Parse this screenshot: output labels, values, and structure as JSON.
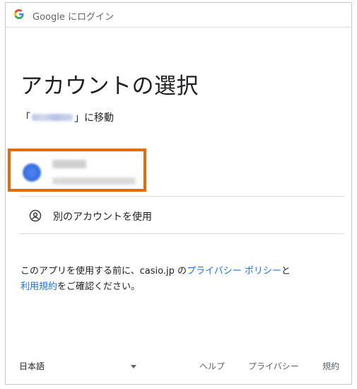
{
  "header": {
    "title": "Google にログイン"
  },
  "main": {
    "heading": "アカウントの選択",
    "subtitle_prefix": "「",
    "subtitle_suffix": "」に移動",
    "other_account_label": "別のアカウントを使用",
    "notice": {
      "part1": "このアプリを使用する前に、casio.jp の",
      "privacy_link": "プライバシー ポリシー",
      "part2": "と",
      "terms_link": "利用規約",
      "part3": "をご確認ください。"
    }
  },
  "footer": {
    "language": "日本語",
    "help": "ヘルプ",
    "privacy": "プライバシー",
    "terms": "規約"
  },
  "colors": {
    "highlight_border": "#e36c0a",
    "link": "#1a73e8"
  }
}
